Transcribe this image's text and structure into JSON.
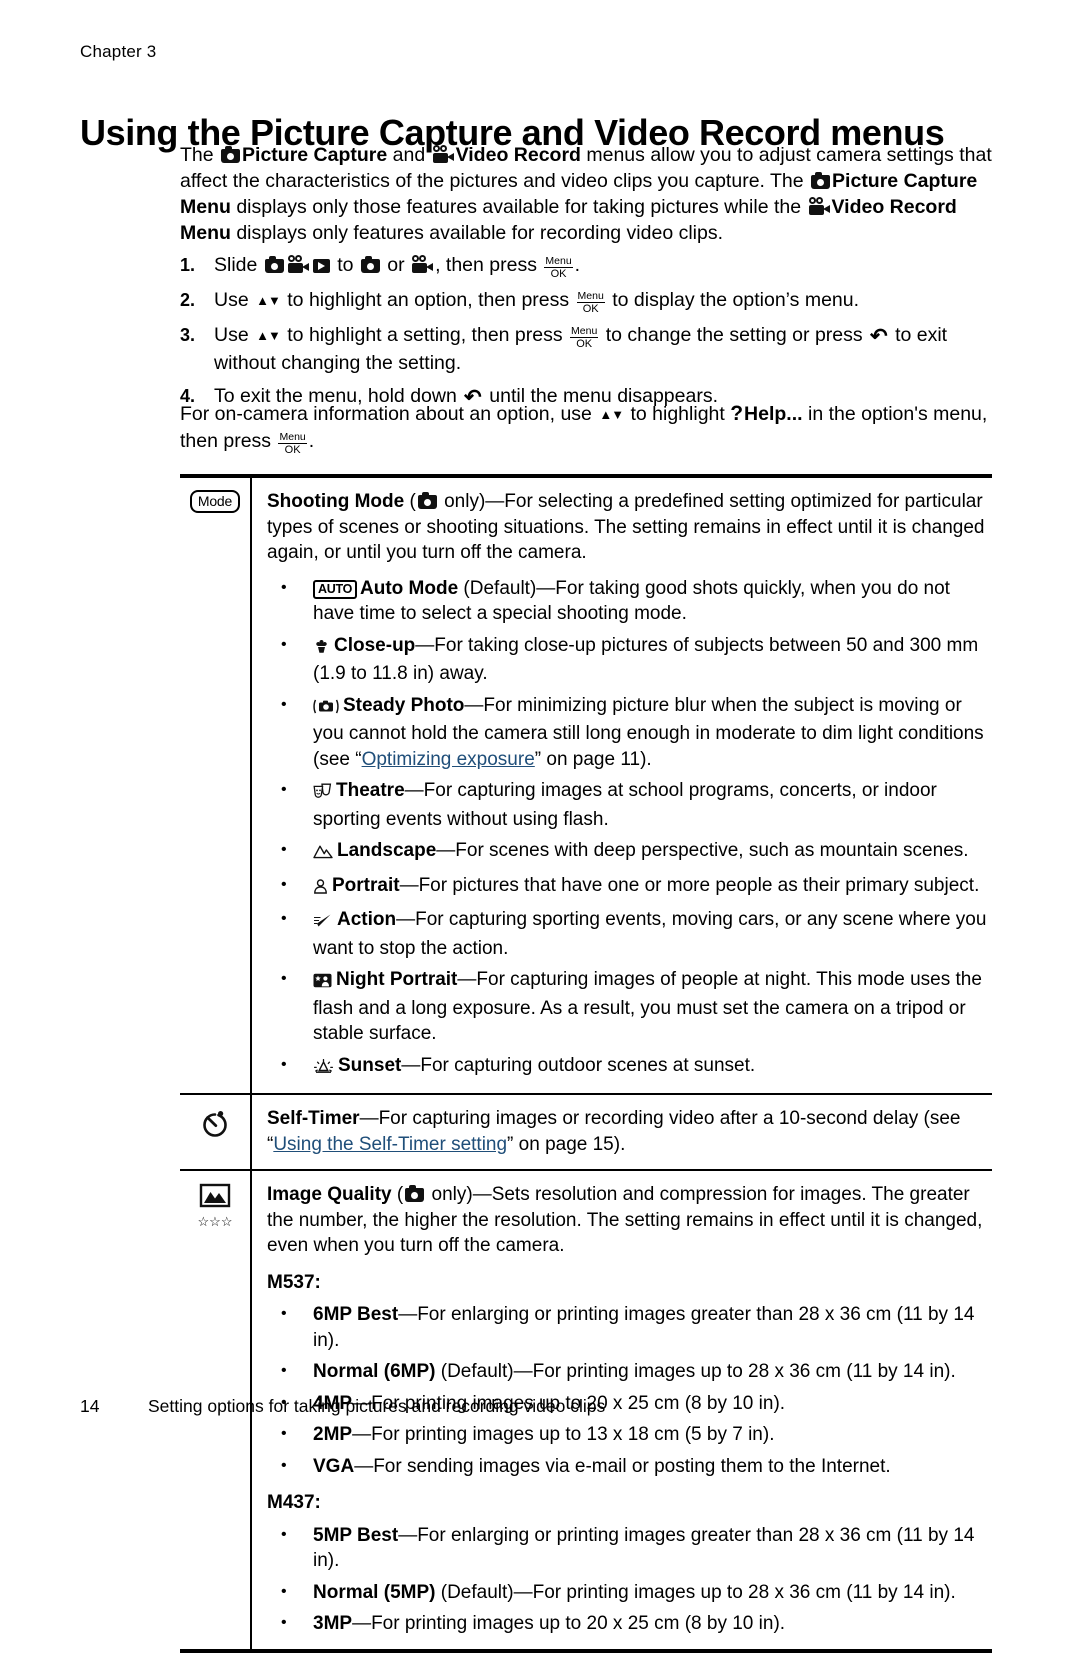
{
  "header": {
    "chapter": "Chapter 3",
    "title": "Using the Picture Capture and Video Record menus"
  },
  "intro": {
    "line_a_1": "The ",
    "line_a_2": "Picture Capture",
    "line_a_3": " and ",
    "line_a_4": "Video Record",
    "line_a_5": " menus allow you to adjust camera settings that affect the characteristics of the pictures and video clips you capture. The ",
    "line_a_6": "Picture Capture Menu",
    "line_a_7": " displays only those features available for taking pictures while the ",
    "line_a_8": "Video Record Menu",
    "line_a_9": " displays only features available for recording video clips."
  },
  "steps": [
    {
      "num": "1.",
      "parts": [
        "Slide ",
        " to ",
        " or ",
        ", then press ",
        "."
      ]
    },
    {
      "num": "2.",
      "parts": [
        "Use ",
        " to highlight an option, then press ",
        " to display the option’s menu."
      ]
    },
    {
      "num": "3.",
      "parts": [
        "Use ",
        " to highlight a setting, then press ",
        " to change the setting or press ",
        " to exit without changing the setting."
      ]
    },
    {
      "num": "4.",
      "parts": [
        "To exit the menu, hold down ",
        " until the menu disappears."
      ]
    }
  ],
  "closing": {
    "part1": "For on-camera information about an option, use ",
    "part2": " to highlight ",
    "help_label": "Help...",
    "part3": " in the option's menu, then press ",
    "part4": "."
  },
  "keys": {
    "menu_top": "Menu",
    "menu_bottom": "OK",
    "mode_key": "Mode",
    "auto_key": "AUTO",
    "help_mark": "?",
    "updown": "▲▼",
    "back": "↷"
  },
  "table": {
    "rows": [
      {
        "icon_name": "mode-key-icon",
        "title": "Shooting Mode",
        "qualifier_open": " (",
        "qualifier_close": " only)",
        "dash": "—",
        "lead": "For selecting a predefined setting optimized for particular types of scenes or shooting situations. The setting remains in effect until it is changed again, or until you turn off the camera.",
        "bullets": [
          {
            "icon": "auto-key-icon",
            "name": "Auto Mode",
            "note": " (Default)",
            "text": "—For taking good shots quickly, when you do not have time to select a special shooting mode."
          },
          {
            "icon": "flower-icon",
            "name": "Close-up",
            "note": "",
            "text": "—For taking close-up pictures of subjects between 50 and 300 mm (1.9 to 11.8 in) away."
          },
          {
            "icon": "steady-photo-icon",
            "name": "Steady Photo",
            "note": "",
            "text": "—For minimizing picture blur when the subject is moving or you cannot hold the camera still long enough in moderate to dim light conditions (see ",
            "link_open": "“",
            "link": "Optimizing exposure",
            "link_close": "” on page 11",
            "text_tail": ")."
          },
          {
            "icon": "theatre-masks-icon",
            "name": "Theatre",
            "note": "",
            "text": "—For capturing images at school programs, concerts, or indoor sporting events without using flash."
          },
          {
            "icon": "landscape-icon",
            "name": "Landscape",
            "note": "",
            "text": "—For scenes with deep perspective, such as mountain scenes."
          },
          {
            "icon": "portrait-icon",
            "name": "Portrait",
            "note": "",
            "text": "—For pictures that have one or more people as their primary subject."
          },
          {
            "icon": "action-icon",
            "name": "Action",
            "note": "",
            "text": "—For capturing sporting events, moving cars, or any scene where you want to stop the action."
          },
          {
            "icon": "night-portrait-icon",
            "name": "Night Portrait",
            "note": "",
            "text": "—For capturing images of people at night. This mode uses the flash and a long exposure. As a result, you must set the camera on a tripod or stable surface."
          },
          {
            "icon": "sunset-icon",
            "name": "Sunset",
            "note": "",
            "text": "—For capturing outdoor scenes at sunset."
          }
        ]
      },
      {
        "icon_name": "self-timer-icon",
        "title": "Self-Timer",
        "dash": "—",
        "lead": "For capturing images or recording video after a 10-second delay (see ",
        "link_open": "“",
        "link": "Using the Self-Timer setting",
        "link_close": "” on page 15",
        "lead_tail": ")."
      },
      {
        "icon_name": "image-quality-icon",
        "title": "Image Quality",
        "qualifier_open": " (",
        "qualifier_close": " only)",
        "dash": "—",
        "lead": "Sets resolution and compression for images. The greater the number, the higher the resolution. The setting remains in effect until it is changed, even when you turn off the camera.",
        "group1_head": "M537:",
        "group1": [
          {
            "name": "6MP Best",
            "note": "",
            "text": "—For enlarging or printing images greater than 28 x 36 cm (11 by 14 in)."
          },
          {
            "name": "Normal (6MP)",
            "note": " (Default)",
            "text": "—For printing images up to 28 x 36 cm (11 by 14 in)."
          },
          {
            "name": "4MP",
            "note": "",
            "text": "—For printing images up to 20 x 25 cm (8 by 10 in)."
          },
          {
            "name": "2MP",
            "note": "",
            "text": "—For printing images up to 13 x 18 cm (5 by 7 in)."
          },
          {
            "name": "VGA",
            "note": "",
            "text": "—For sending images via e-mail or posting them to the Internet."
          }
        ],
        "group2_head": "M437:",
        "group2": [
          {
            "name": "5MP Best",
            "note": "",
            "text": "—For enlarging or printing images greater than 28 x 36 cm (11 by 14 in)."
          },
          {
            "name": "Normal (5MP)",
            "note": " (Default)",
            "text": "—For printing images up to 28 x 36 cm (11 by 14 in)."
          },
          {
            "name": "3MP",
            "note": "",
            "text": "—For printing images up to 20 x 25 cm (8 by 10 in)."
          }
        ]
      }
    ]
  },
  "footer": {
    "page_number": "14",
    "text": "Setting options for taking pictures and recording video clips"
  },
  "colors": {
    "text": "#000000",
    "link": "#1f4e79",
    "rule": "#000000"
  },
  "stars": "☆☆☆"
}
